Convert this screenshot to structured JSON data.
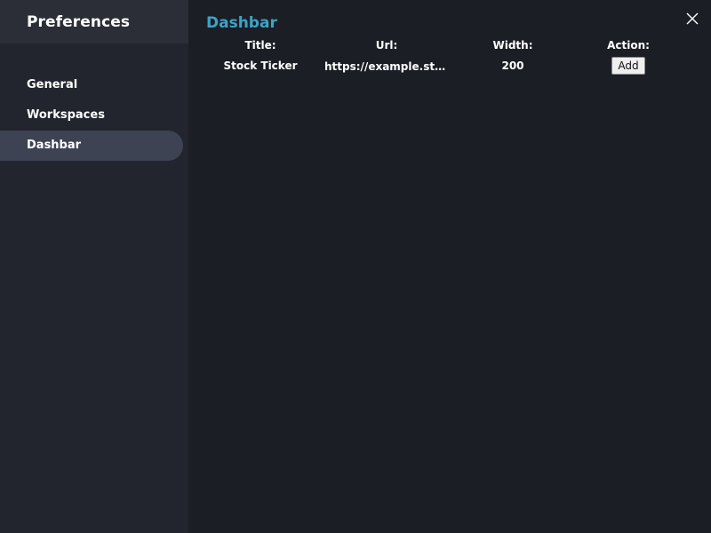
{
  "sidebar": {
    "title": "Preferences",
    "items": [
      {
        "label": "General"
      },
      {
        "label": "Workspaces"
      },
      {
        "label": "Dashbar"
      }
    ],
    "active_index": 2
  },
  "main": {
    "title": "Dashbar",
    "table": {
      "headers": {
        "title": "Title:",
        "url": "Url:",
        "width": "Width:",
        "action": "Action:"
      },
      "rows": [
        {
          "title": "Stock Ticker",
          "url": "https://example.stock...",
          "width": "200",
          "action_label": "Add"
        }
      ]
    }
  },
  "colors": {
    "background": "#1b1e25",
    "sidebar": "#22252d",
    "sidebar_header": "#2b2e36",
    "active_item": "#3e4354",
    "accent": "#3ea3c6"
  },
  "icons": {
    "close": "close-icon"
  }
}
